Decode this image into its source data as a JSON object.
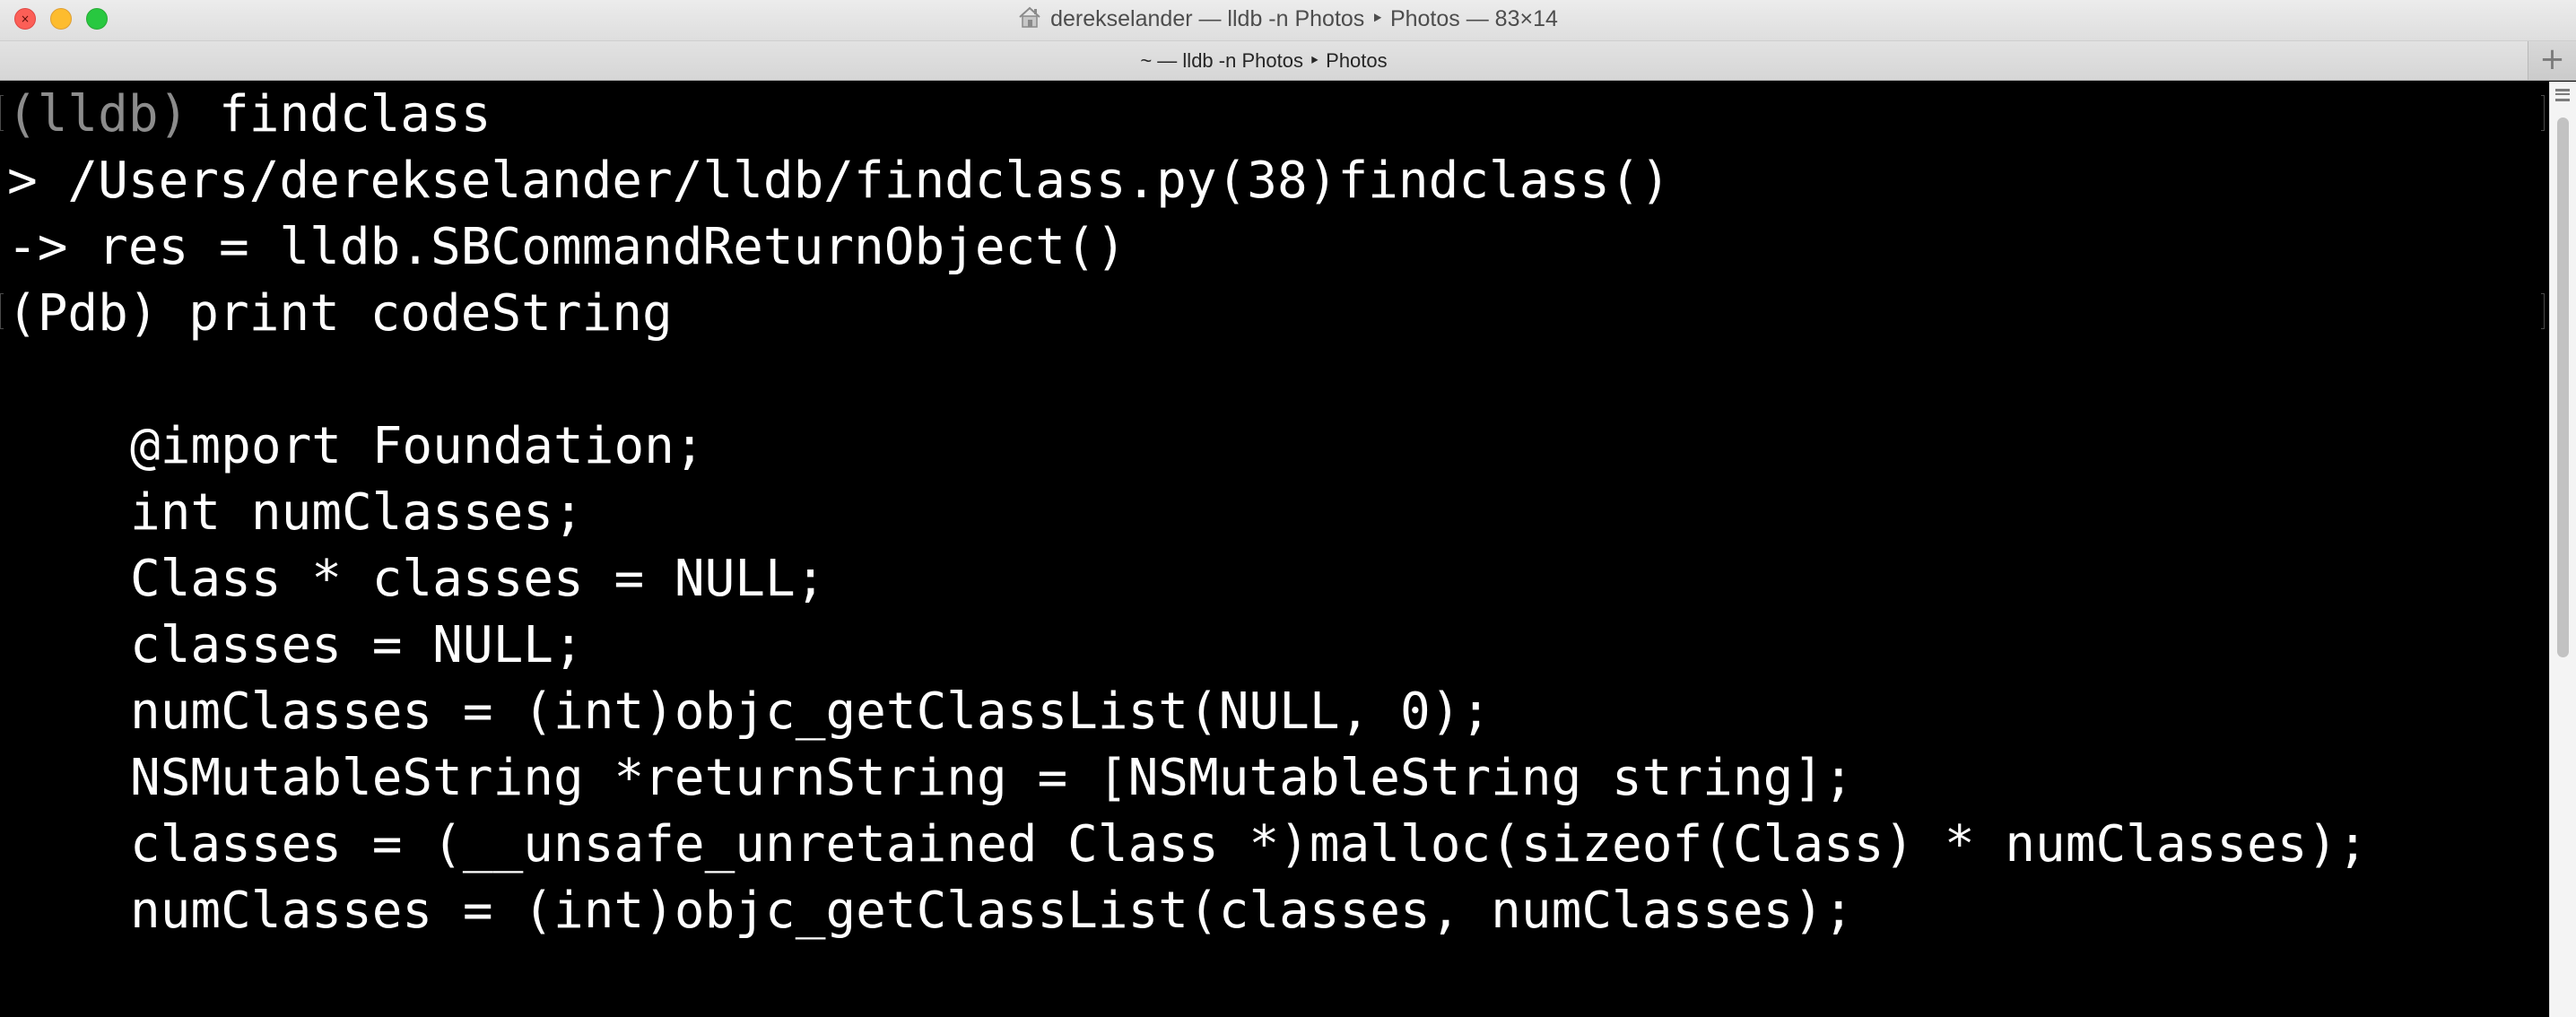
{
  "window": {
    "title": "derekselander — lldb -n Photos ‣ Photos — 83×14",
    "home_icon": "house-icon",
    "traffic_lights": {
      "close": "#fc5f57",
      "minimize": "#fdbc2e",
      "zoom": "#28c840"
    }
  },
  "tabs": [
    {
      "label": "~ — lldb -n Photos ‣ Photos"
    }
  ],
  "new_tab_glyph": "+",
  "terminal": {
    "background": "#000000",
    "foreground": "#ffffff",
    "prompt_color": "#8c8c8c",
    "lines": [
      {
        "prompt": "(lldb)",
        "text": " findclass"
      },
      {
        "text": "> /Users/derekselander/lldb/findclass.py(38)findclass()"
      },
      {
        "text": "-> res = lldb.SBCommandReturnObject()"
      },
      {
        "text": "(Pdb) print codeString"
      },
      {
        "text": ""
      },
      {
        "text": "@import Foundation;"
      },
      {
        "text": "int numClasses;"
      },
      {
        "text": "Class * classes = NULL;"
      },
      {
        "text": "classes = NULL;"
      },
      {
        "text": "numClasses = (int)objc_getClassList(NULL, 0);"
      },
      {
        "text": "NSMutableString *returnString = [NSMutableString string];"
      },
      {
        "text": "classes = (__unsafe_unretained Class *)malloc(sizeof(Class) * numClasses);"
      },
      {
        "text": "numClasses = (int)objc_getClassList(classes, numClasses);"
      }
    ]
  },
  "scrollbar": {
    "position": 0.0,
    "visible_fraction": 0.58
  }
}
